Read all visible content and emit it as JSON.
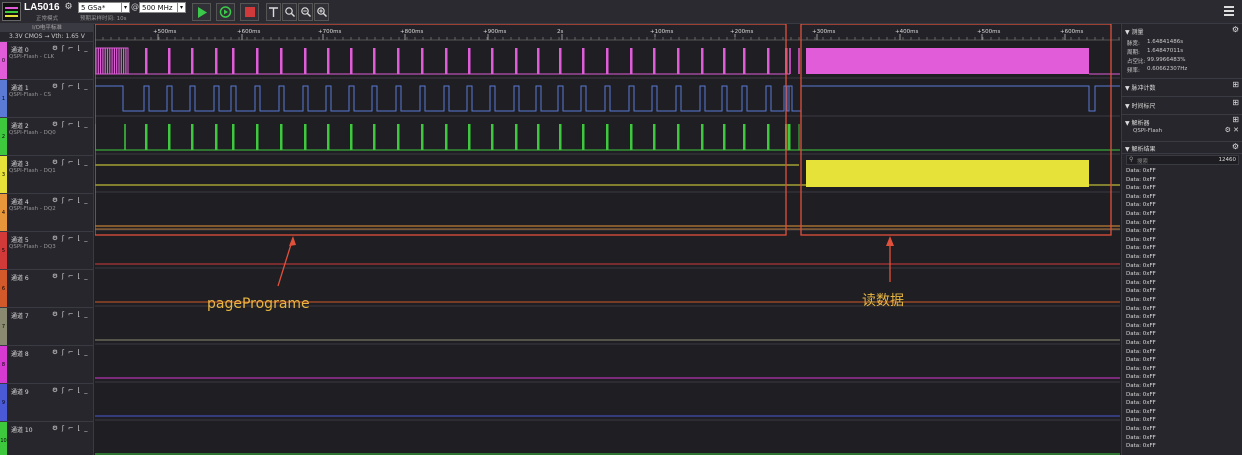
{
  "toolbar": {
    "device_name": "LA5016",
    "device_mode": "正常模式",
    "sample_rate": "5 GSa*",
    "at": "@",
    "frequency": "500 MHz",
    "hint": "预期采样时间: 10s",
    "run_color": "#3cc84a",
    "stop_color": "#d03a3a"
  },
  "left_panel": {
    "top_label": "I/O电平标准",
    "io_standard": "3.3V CMOS  →  Vth: 1.65 V",
    "channels": [
      {
        "num": "0",
        "label": "通道 0",
        "sub": "QSPI-Flash - CLK",
        "color": "#e05cd8"
      },
      {
        "num": "1",
        "label": "通道 1",
        "sub": "QSPI-Flash - CS",
        "color": "#5a7ad6"
      },
      {
        "num": "2",
        "label": "通道 2",
        "sub": "QSPI-Flash - DQ0",
        "color": "#3ec83e"
      },
      {
        "num": "3",
        "label": "通道 3",
        "sub": "QSPI-Flash - DQ1",
        "color": "#e6e23a"
      },
      {
        "num": "4",
        "label": "通道 4",
        "sub": "QSPI-Flash - DQ2",
        "color": "#e8963a"
      },
      {
        "num": "5",
        "label": "通道 5",
        "sub": "QSPI-Flash - DQ3",
        "color": "#d23a3a"
      },
      {
        "num": "6",
        "label": "通道 6",
        "sub": "",
        "color": "#d25a2a"
      },
      {
        "num": "7",
        "label": "通道 7",
        "sub": "",
        "color": "#8a8a70"
      },
      {
        "num": "8",
        "label": "通道 8",
        "sub": "",
        "color": "#d63ad0"
      },
      {
        "num": "9",
        "label": "通道 9",
        "sub": "",
        "color": "#4a5ad6"
      },
      {
        "num": "10",
        "label": "通道 10",
        "sub": "",
        "color": "#3ec83e"
      }
    ]
  },
  "timeline": {
    "ticks": [
      "+500ms",
      "+600ms",
      "+700ms",
      "+800ms",
      "+900ms",
      "2s",
      "+100ms",
      "+200ms",
      "+300ms",
      "+400ms",
      "+500ms",
      "+600ms"
    ]
  },
  "annotations": {
    "left": "pagePrograme",
    "right": "读数据",
    "box_color": "#e0503a",
    "text_color": "#e8b640"
  },
  "right_panel": {
    "measure_title": "测量",
    "measure": [
      {
        "k": "脉宽:",
        "v": "1.64841486s"
      },
      {
        "k": "周期:",
        "v": "1.64847011s"
      },
      {
        "k": "占空比:",
        "v": "99.9966483%"
      },
      {
        "k": "频率:",
        "v": "0.60662307Hz"
      }
    ],
    "counter_title": "脉冲计数",
    "ruler_title": "时间标尺",
    "decoder_title": "解析器",
    "decoder_item": "QSPI-Flash",
    "results_title": "解析结果",
    "search_placeholder": "搜索",
    "result_count": "12460",
    "result_line": "Data: 0xFF",
    "result_lines": [
      "Data: 0xFF",
      "Data: 0xFF",
      "Data: 0xFF",
      "Data: 0xFF",
      "Data: 0xFF",
      "Data: 0xFF",
      "Data: 0xFF",
      "Data: 0xFF",
      "Data: 0xFF",
      "Data: 0xFF",
      "Data: 0xFF",
      "Data: 0xFF",
      "Data: 0xFF",
      "Data: 0xFF",
      "Data: 0xFF",
      "Data: 0xFF",
      "Data: 0xFF",
      "Data: 0xFF",
      "Data: 0xFF",
      "Data: 0xFF",
      "Data: 0xFF",
      "Data: 0xFF",
      "Data: 0xFF",
      "Data: 0xFF",
      "Data: 0xFF",
      "Data: 0xFF",
      "Data: 0xFF",
      "Data: 0xFF",
      "Data: 0xFF",
      "Data: 0xFF",
      "Data: 0xFF",
      "Data: 0xFF",
      "Data: 0xFF"
    ]
  }
}
